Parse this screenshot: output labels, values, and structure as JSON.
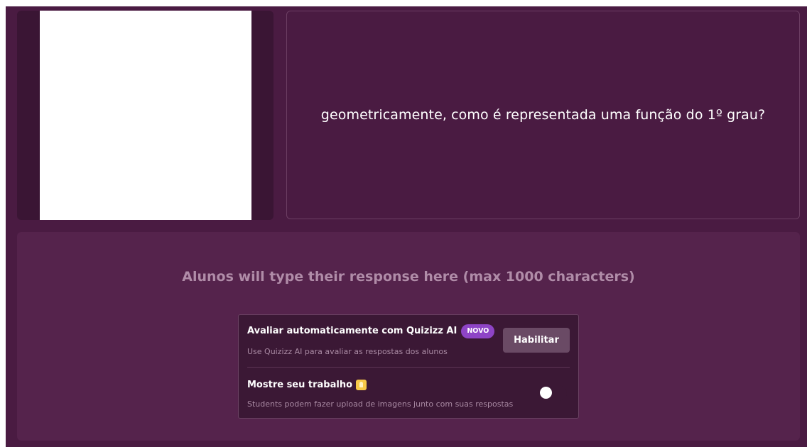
{
  "question": {
    "text": "geometricamente, como é representada uma função do 1º grau?"
  },
  "answer": {
    "placeholder": "Alunos will type their response here (max 1000 characters)"
  },
  "settings": {
    "auto_grade": {
      "title": "Avaliar automaticamente com Quizizz AI",
      "badge": "NOVO",
      "description": "Use Quizizz AI para avaliar as respostas dos alunos",
      "button_label": "Habilitar"
    },
    "show_work": {
      "title": "Mostre seu trabalho",
      "icon": "lightbulb-icon",
      "description": "Students podem fazer upload de imagens junto com suas respostas",
      "toggle_on": false
    }
  },
  "colors": {
    "background": "#4a1b42",
    "answer_panel": "#55234c",
    "badge": "#8e44c6",
    "icon": "#f7c948"
  }
}
